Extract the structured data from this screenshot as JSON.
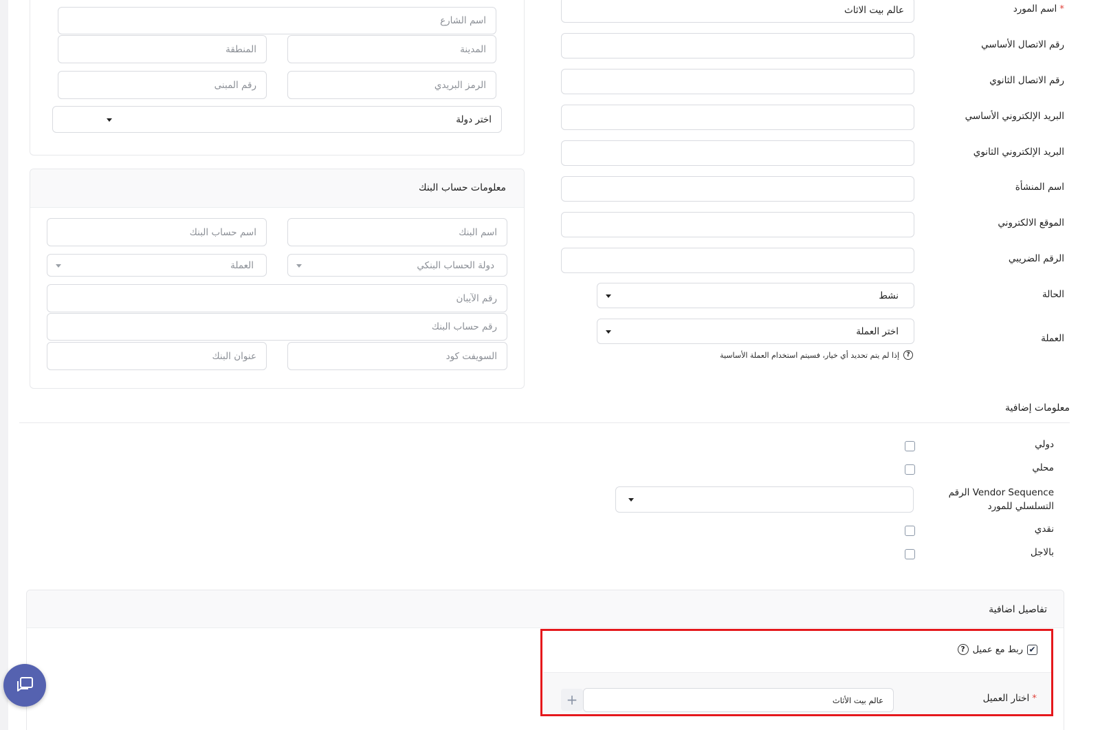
{
  "vendor_form": {
    "vendor_name": {
      "label": "اسم المورد",
      "required_mark": "*",
      "value": "عالم بيت الاثاث"
    },
    "primary_phone": {
      "label": "رقم الاتصال الأساسي",
      "value": ""
    },
    "secondary_phone": {
      "label": "رقم الاتصال الثانوي",
      "value": ""
    },
    "primary_email": {
      "label": "البريد الإلكتروني الأساسي",
      "value": ""
    },
    "secondary_email": {
      "label": "البريد الإلكتروني الثانوي",
      "value": ""
    },
    "company_name": {
      "label": "اسم المنشأة",
      "value": ""
    },
    "website": {
      "label": "الموقع الالكتروني",
      "value": ""
    },
    "tax_number": {
      "label": "الرقم الضريبي",
      "value": ""
    },
    "status": {
      "label": "الحالة",
      "value": "نشط"
    },
    "currency": {
      "label": "العملة",
      "placeholder": "اختر العملة",
      "hint": "إذا لم يتم تحديد أي خيار، فسيتم استخدام العملة الأساسية",
      "hint_icon": "question-circle-icon"
    }
  },
  "address": {
    "street": "اسم الشارع",
    "city": "المدينة",
    "district": "المنطقة",
    "postal_code": "الرمز البريدي",
    "building_number": "رقم المبنى",
    "country": "اختر دولة"
  },
  "bank": {
    "title": "معلومات حساب البنك",
    "bank_name": "اسم البنك",
    "account_name": "اسم حساب البنك",
    "bank_country": "دولة الحساب البنكي",
    "currency": "العملة",
    "iban": "رقم الآيبان",
    "account_number": "رقم حساب البنك",
    "swift": "السويفت كود",
    "bank_address": "عنوان البنك"
  },
  "extra_info": {
    "title": "معلومات إضافية",
    "international": "دولي",
    "local": "محلي",
    "sequence_label": "Vendor Sequence الرقم التسلسلي للمورد",
    "cash": "نقدي",
    "credit": "بالاجل"
  },
  "additional_details": {
    "title": "تفاصيل اضافية",
    "link_customer": "ربط مع عميل",
    "link_customer_checked": true,
    "select_customer": {
      "label": "اختار العميل",
      "required_mark": "*",
      "value": "عالم بيت الأثاث"
    },
    "add_icon": "plus-icon"
  },
  "icons": {
    "chat": "chat-icon",
    "caret": "chevron-down-icon"
  },
  "colors": {
    "required": "#e0443c",
    "highlight": "#e5181c",
    "chat_button": "#5562b0",
    "checkbox_border": "#8c98a8"
  }
}
